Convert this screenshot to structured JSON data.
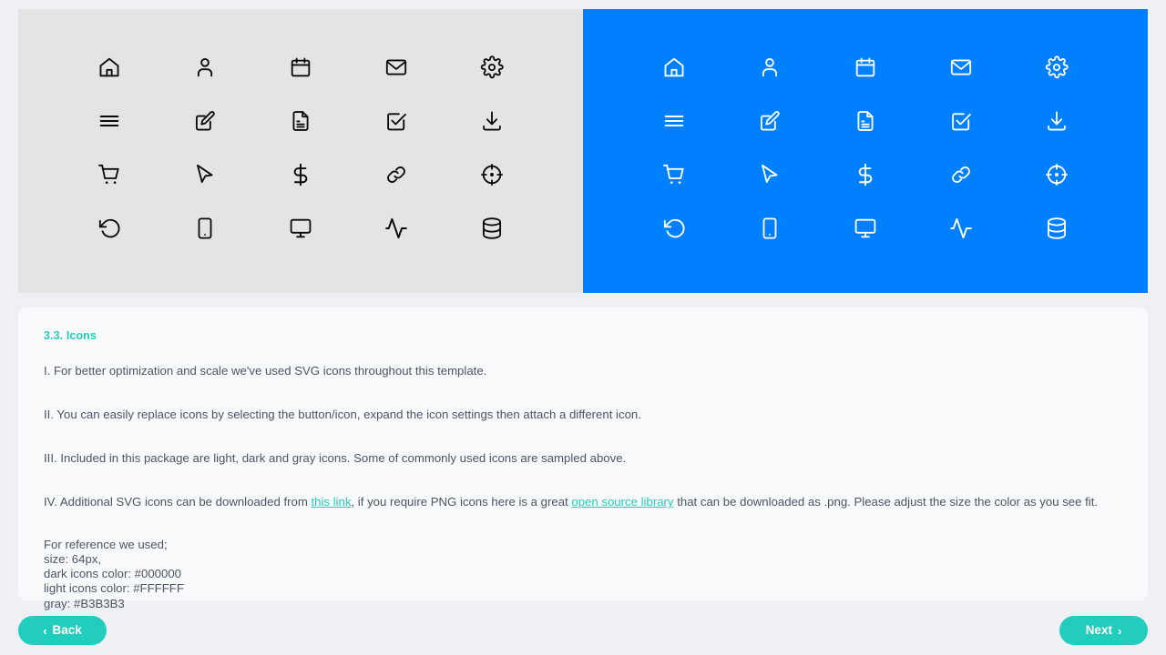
{
  "showcase": {
    "dark_panel": {
      "label": "dark-icons-panel",
      "background": "#E4E4E4",
      "icon_color": "#000000",
      "icons": [
        "home-icon",
        "user-icon",
        "calendar-icon",
        "mail-icon",
        "settings-gear-icon",
        "menu-hamburger-icon",
        "edit-pencil-icon",
        "document-file-icon",
        "checkbox-checked-icon",
        "download-icon",
        "shopping-cart-icon",
        "cursor-pointer-icon",
        "dollar-sign-icon",
        "link-chain-icon",
        "crosshair-target-icon",
        "rotate-undo-icon",
        "mobile-phone-icon",
        "monitor-desktop-icon",
        "activity-pulse-icon",
        "database-icon"
      ]
    },
    "light_panel": {
      "label": "light-icons-panel",
      "background": "#0080FF",
      "icon_color": "#FFFFFF",
      "icons": [
        "home-icon",
        "user-icon",
        "calendar-icon",
        "mail-icon",
        "settings-gear-icon",
        "menu-hamburger-icon",
        "edit-pencil-icon",
        "document-file-icon",
        "checkbox-checked-icon",
        "download-icon",
        "shopping-cart-icon",
        "cursor-pointer-icon",
        "dollar-sign-icon",
        "link-chain-icon",
        "crosshair-target-icon",
        "rotate-undo-icon",
        "mobile-phone-icon",
        "monitor-desktop-icon",
        "activity-pulse-icon",
        "database-icon"
      ]
    }
  },
  "content": {
    "section_title": "3.3. Icons",
    "para_1": "I. For better optimization and scale we've used SVG icons throughout this template.",
    "para_2": "II. You can easily replace icons by selecting the button/icon, expand the icon settings then attach a different icon.",
    "para_3": "III. Included in this package are light, dark and gray icons. Some of commonly used icons are sampled above.",
    "para_4": {
      "part_1": "IV. Additional SVG icons can be downloaded from ",
      "link_1": "this link",
      "part_2": ", if you require PNG icons here is a great ",
      "link_2": "open source library",
      "part_3": " that can be downloaded as .png. Please adjust the size the color as you see fit."
    },
    "reference": "For reference we used;\nsize: 64px,\ndark icons color: #000000\nlight icons color: #FFFFFF\ngray: #B3B3B3"
  },
  "footer": {
    "back_label": "Back",
    "back_chevron": "‹",
    "next_label": "Next",
    "next_chevron": "›"
  },
  "theme": {
    "accent": "#22CDBE",
    "page_background": "#EEF0F4",
    "card_background": "#F8F9FB",
    "blue_panel": "#0080FF",
    "gray_panel": "#E4E4E4",
    "text": "#4B5563"
  }
}
